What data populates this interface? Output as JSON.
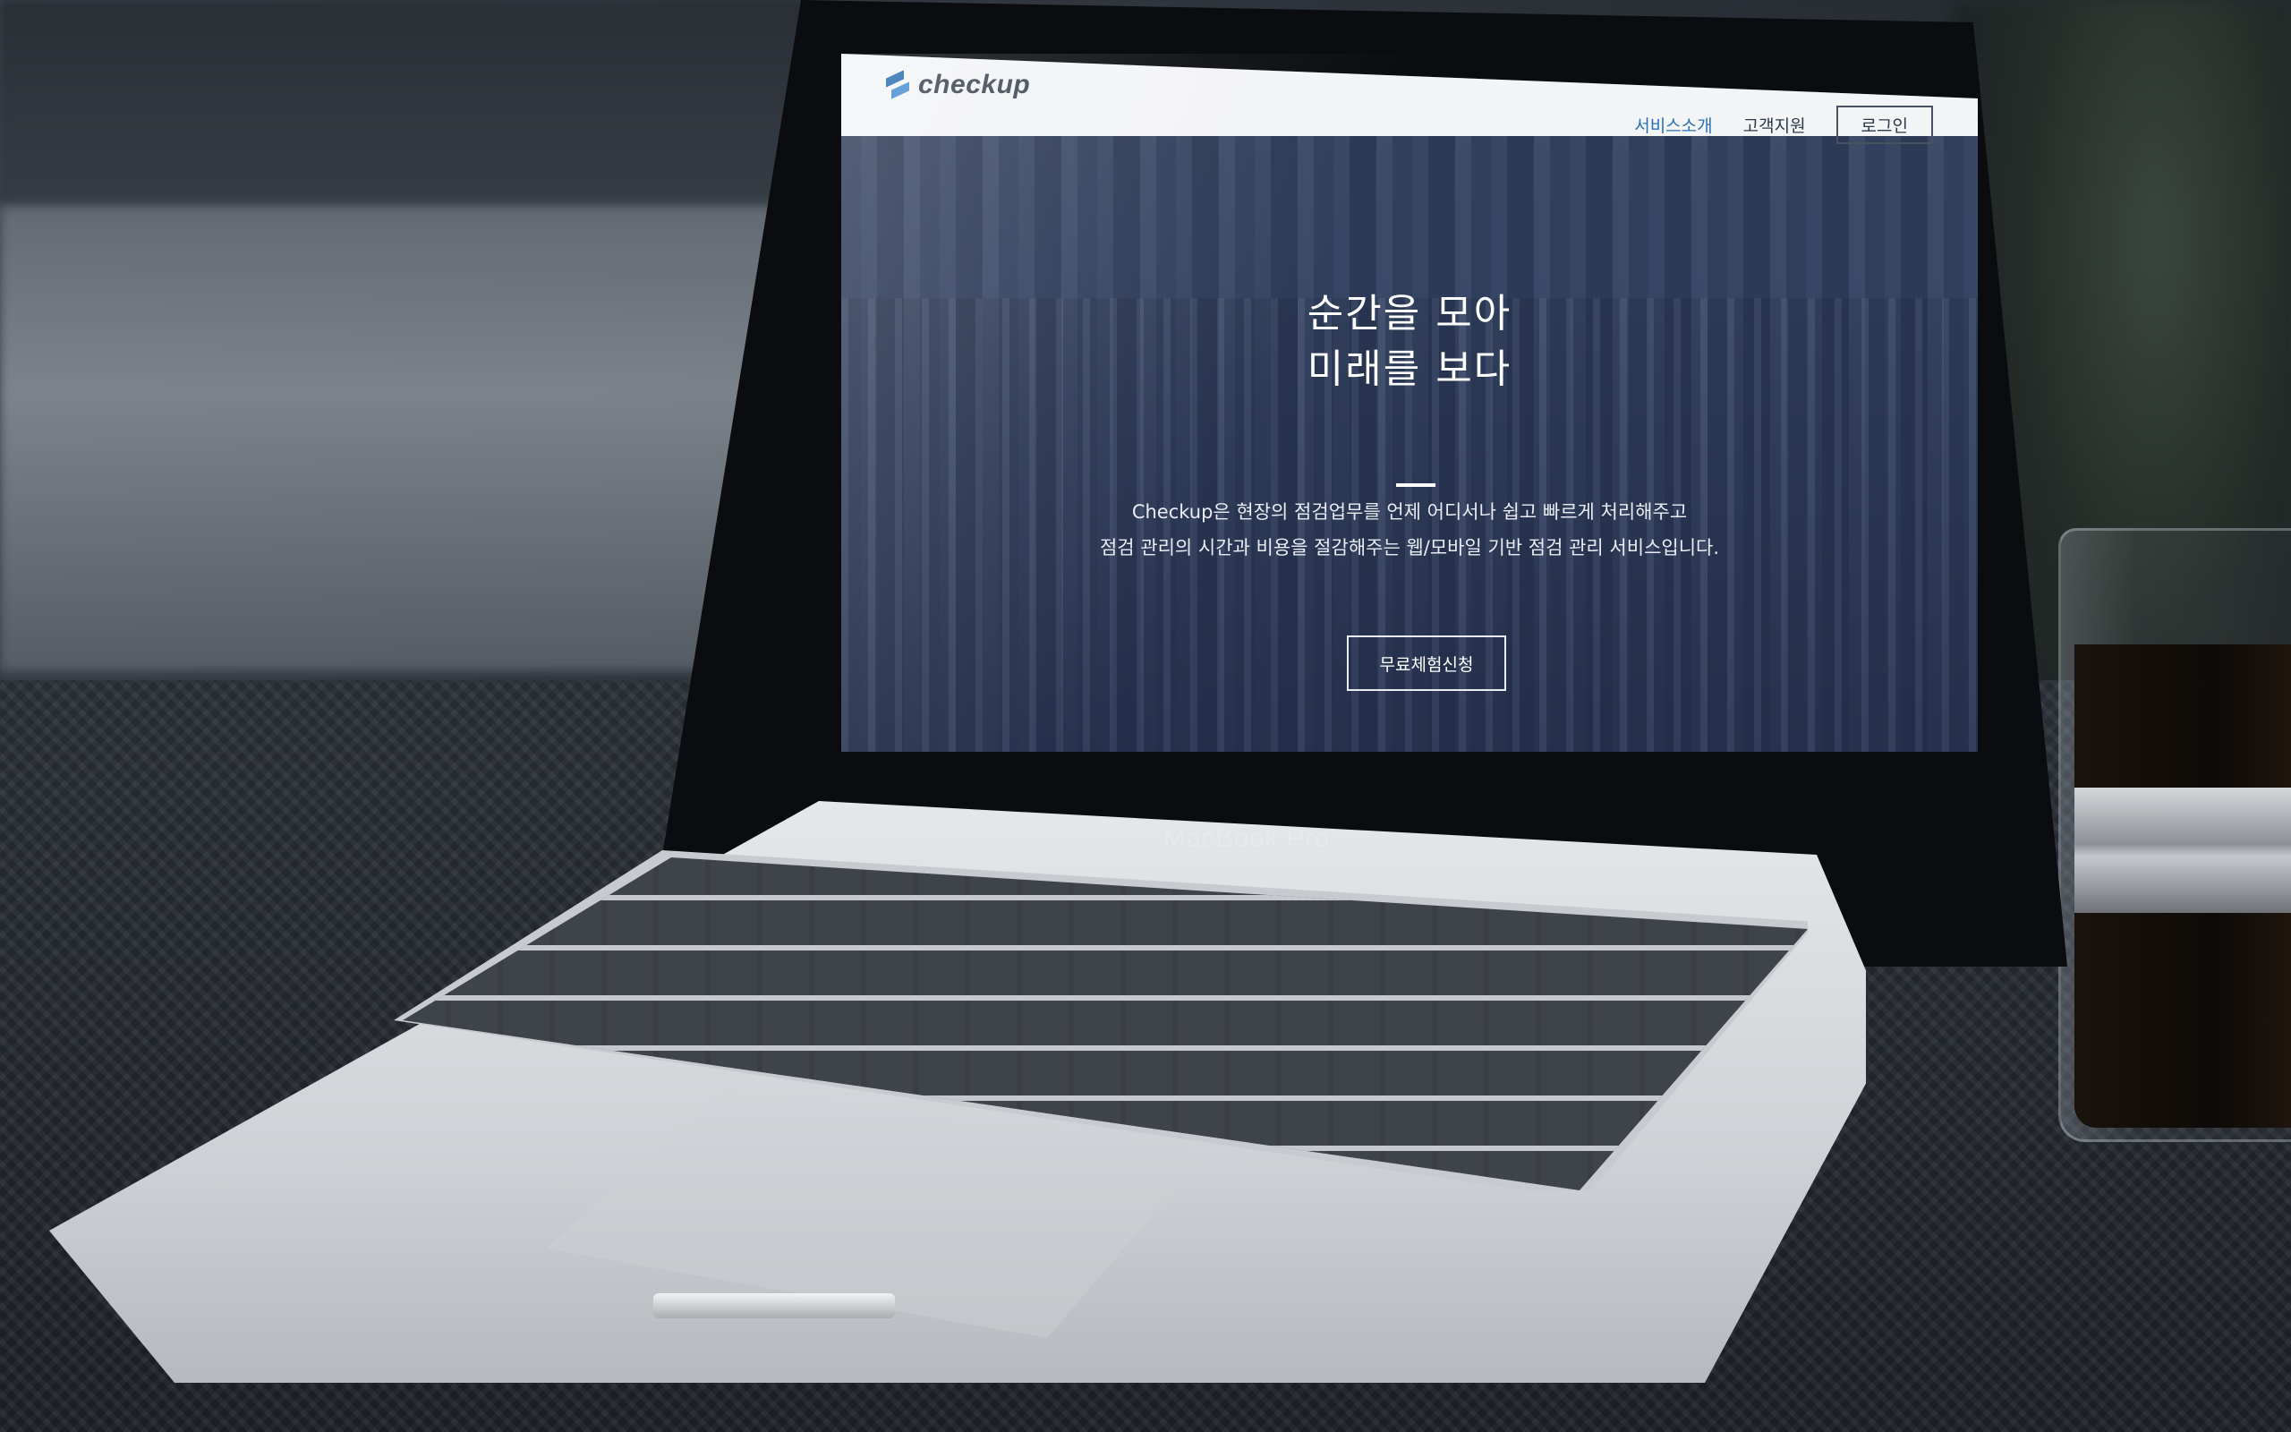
{
  "site": {
    "logo_text": "checkup",
    "nav": {
      "items": [
        {
          "label": "서비스소개",
          "active": true
        },
        {
          "label": "고객지원",
          "active": false
        }
      ],
      "login_label": "로그인"
    },
    "hero": {
      "title_line1": "순간을 모아",
      "title_line2": "미래를 보다",
      "desc_line1": "Checkup은 현장의 점검업무를 언제 어디서나 쉽고 빠르게 처리해주고",
      "desc_line2": "점검 관리의 시간과 비용을 절감해주는 웹/모바일 기반 점검 관리 서비스입니다.",
      "cta_label": "무료체험신청"
    }
  },
  "device": {
    "brand_label": "MacBook Pro"
  },
  "colors": {
    "accent": "#2d6fb6",
    "nav_bg": "#f3f4f6",
    "hero_overlay": "#2f3d5e",
    "text_dark": "#2d3a4b"
  },
  "icons": {
    "logo": "checkup-logo-mark"
  }
}
